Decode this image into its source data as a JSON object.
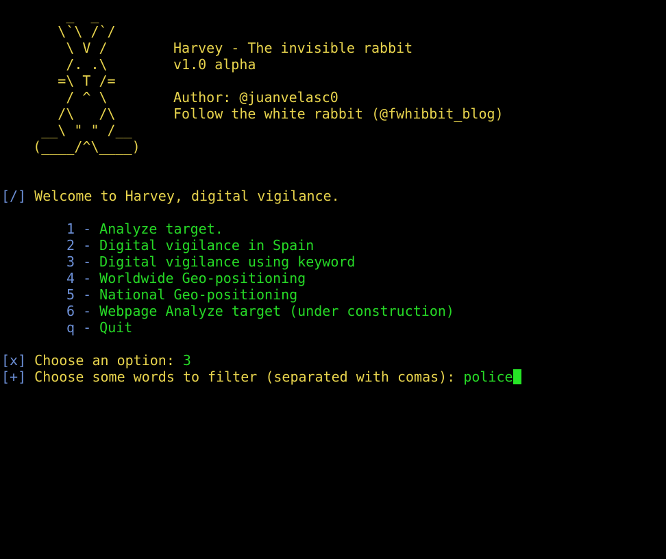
{
  "banner": {
    "art": [
      "        _  _",
      "       \\`\\ /`/",
      "        \\ V /",
      "        /. .\\",
      "       =\\ T /=",
      "        / ^ \\",
      "       /\\   /\\",
      "     __\\ \" \" /__",
      "    (____/^\\____)"
    ],
    "title": "Harvey - The invisible rabbit",
    "version": "v1.0 alpha",
    "author": "Author: @juanvelasc0",
    "follow": "Follow the white rabbit (@fwhibbit_blog)"
  },
  "welcome": {
    "tag": "[/]",
    "text": " Welcome to Harvey, digital vigilance."
  },
  "menu": [
    {
      "key": "1",
      "label": "Analyze target."
    },
    {
      "key": "2",
      "label": "Digital vigilance in Spain"
    },
    {
      "key": "3",
      "label": "Digital vigilance using keyword"
    },
    {
      "key": "4",
      "label": "Worldwide Geo-positioning"
    },
    {
      "key": "5",
      "label": "National Geo-positioning"
    },
    {
      "key": "6",
      "label": "Webpage Analyze target (under construction)"
    },
    {
      "key": "q",
      "label": "Quit"
    }
  ],
  "menu_separator": " - ",
  "prompt_option": {
    "tag": "[x]",
    "text": " Choose an option: ",
    "value": "3"
  },
  "prompt_filter": {
    "tag": "[+]",
    "text": " Choose some words to filter (separated with comas): ",
    "value": "police"
  },
  "colors": {
    "background": "#000000",
    "yellow": "#e8d44d",
    "green": "#26d926",
    "blue": "#6c8fd6"
  }
}
